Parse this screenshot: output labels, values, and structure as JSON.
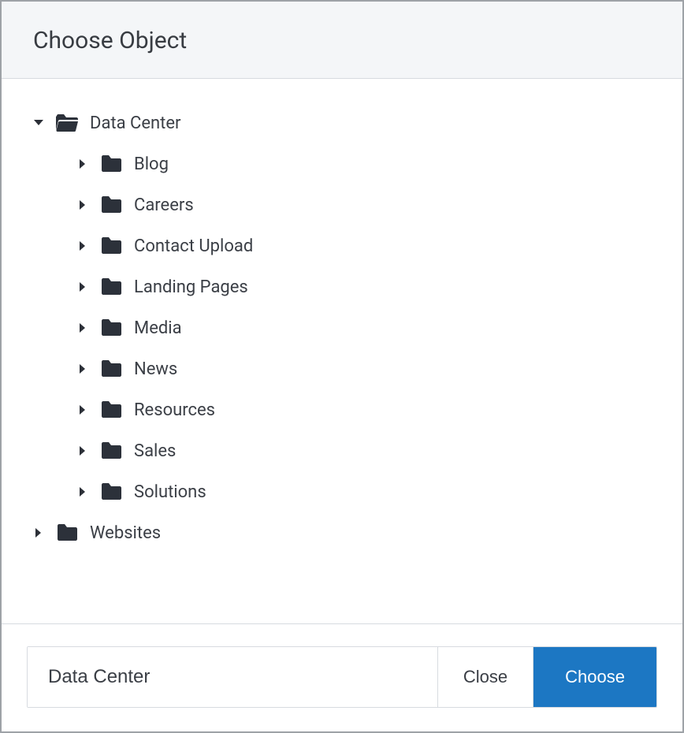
{
  "header": {
    "title": "Choose Object"
  },
  "tree": {
    "root_label": "Data Center",
    "root_expanded": true,
    "children": [
      {
        "label": "Blog",
        "expanded": false
      },
      {
        "label": "Careers",
        "expanded": false
      },
      {
        "label": "Contact Upload",
        "expanded": false
      },
      {
        "label": "Landing Pages",
        "expanded": false
      },
      {
        "label": "Media",
        "expanded": false
      },
      {
        "label": "News",
        "expanded": false
      },
      {
        "label": "Resources",
        "expanded": false
      },
      {
        "label": "Sales",
        "expanded": false
      },
      {
        "label": "Solutions",
        "expanded": false
      }
    ],
    "siblings": [
      {
        "label": "Websites",
        "expanded": false
      }
    ]
  },
  "footer": {
    "selected": "Data Center",
    "close_label": "Close",
    "choose_label": "Choose"
  },
  "colors": {
    "primary": "#1c77c3",
    "folder": "#2c313a"
  }
}
